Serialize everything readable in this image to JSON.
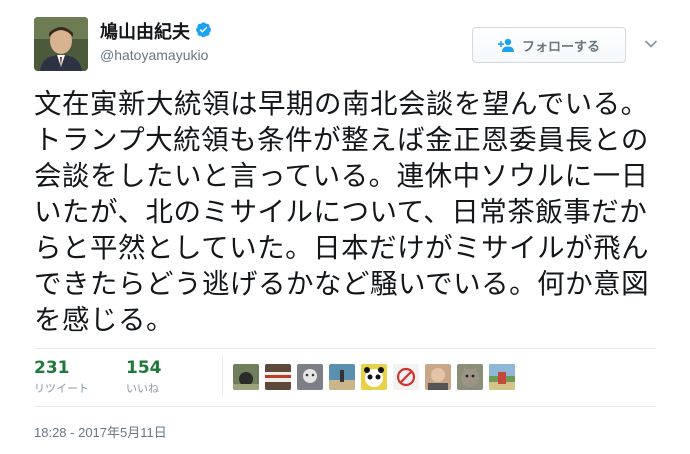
{
  "user": {
    "name": "鳩山由紀夫",
    "handle": "@hatoyamayukio"
  },
  "follow_button": {
    "label": "フォローする"
  },
  "tweet": {
    "text": "文在寅新大統領は早期の南北会談を望んでいる。トランプ大統領も条件が整えば金正恩委員長との会談をしたいと言っている。連休中ソウルに一日いたが、北のミサイルについて、日常茶飯事だからと平然としていた。日本だけがミサイルが飛んできたらどう逃げるかなど騒いでいる。何か意図を感じる。"
  },
  "stats": {
    "retweets": {
      "count": "231",
      "label": "リツイート"
    },
    "likes": {
      "count": "154",
      "label": "いいね"
    }
  },
  "liker_avatars": [
    {
      "name": "liker-avatar-1",
      "color": "#6f7f5e"
    },
    {
      "name": "liker-avatar-2",
      "color": "#5d4a3b"
    },
    {
      "name": "liker-avatar-3",
      "color": "#7d7f86"
    },
    {
      "name": "liker-avatar-4",
      "color": "#5b8fb0"
    },
    {
      "name": "liker-avatar-5",
      "color": "#e8d24a"
    },
    {
      "name": "liker-avatar-6",
      "color": "#f2f2f2"
    },
    {
      "name": "liker-avatar-7",
      "color": "#c9a58a"
    },
    {
      "name": "liker-avatar-8",
      "color": "#8a8f7a"
    },
    {
      "name": "liker-avatar-9",
      "color": "#6f9a55"
    }
  ],
  "timestamp": "18:28 - 2017年5月11日",
  "colors": {
    "verified": "#1da1f2",
    "retweet_count": "#1f7a3a",
    "like_count": "#1f7a3a"
  }
}
